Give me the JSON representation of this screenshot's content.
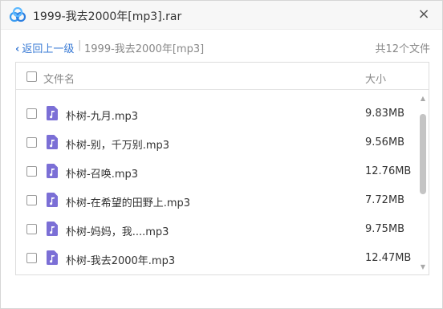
{
  "window": {
    "title": "1999-我去2000年[mp3].rar",
    "close_label": "×",
    "logo_icon": "baidu-netdisk-cloud-icon"
  },
  "nav": {
    "back_label": "返回上一级",
    "separator": "|",
    "path": "1999-我去2000年[mp3]",
    "file_count": "共12个文件"
  },
  "list": {
    "header": {
      "name": "文件名",
      "size": "大小"
    },
    "rows": [
      {
        "name": "朴树-九月.mp3",
        "size": "9.83MB"
      },
      {
        "name": "朴树-别，千万别.mp3",
        "size": "9.56MB"
      },
      {
        "name": "朴树-召唤.mp3",
        "size": "12.76MB"
      },
      {
        "name": "朴树-在希望的田野上.mp3",
        "size": "7.72MB"
      },
      {
        "name": "朴树-妈妈，我....mp3",
        "size": "9.75MB"
      },
      {
        "name": "朴树-我去2000年.mp3",
        "size": "12.47MB"
      }
    ],
    "file_icon": "music-file-icon"
  },
  "colors": {
    "accent": "#3a7bd5",
    "file_icon": "#7b6fd6"
  }
}
